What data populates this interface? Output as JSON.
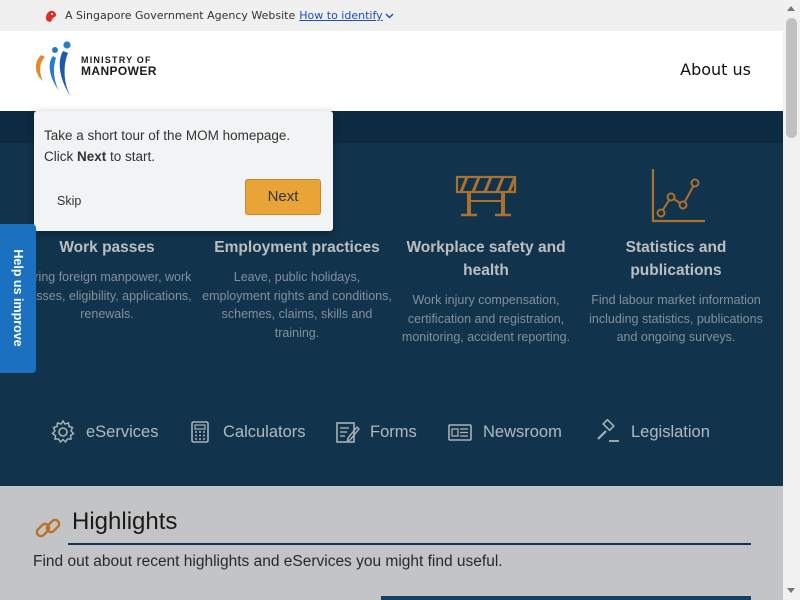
{
  "gov_banner": {
    "text": "A Singapore Government Agency Website",
    "link": "How to identify"
  },
  "header": {
    "logo_line1": "MINISTRY OF",
    "logo_line2": "MANPOWER",
    "about_us": "About us"
  },
  "categories": [
    {
      "title": "Work passes",
      "desc": "Hiring foreign manpower, work passes, eligibility, applications, renewals.",
      "icon": "id-card-icon"
    },
    {
      "title": "Employment practices",
      "desc": "Leave, public holidays, employment rights and conditions, schemes, claims, skills and training.",
      "icon": "envelope-icon"
    },
    {
      "title": "Workplace safety and health",
      "desc": "Work injury compensation, certification and registration, monitoring, accident reporting.",
      "icon": "barricade-icon"
    },
    {
      "title": "Statistics and publications",
      "desc": "Find labour market information including statistics, publications and ongoing surveys.",
      "icon": "line-chart-icon"
    }
  ],
  "quick_links": [
    {
      "label": "eServices",
      "icon": "gear-icon"
    },
    {
      "label": "Calculators",
      "icon": "calculator-icon"
    },
    {
      "label": "Forms",
      "icon": "form-icon"
    },
    {
      "label": "Newsroom",
      "icon": "newspaper-icon"
    },
    {
      "label": "Legislation",
      "icon": "gavel-icon"
    }
  ],
  "highlights": {
    "title": "Highlights",
    "desc": "Find out about recent highlights and eServices you might find useful."
  },
  "tour": {
    "line1": "Take a short tour of the MOM homepage.",
    "line2_pre": "Click ",
    "line2_bold": "Next",
    "line2_post": " to start.",
    "skip": "Skip",
    "next": "Next"
  },
  "feedback_tab": "Help us improve",
  "colors": {
    "hero_bg": "#153f5c",
    "tour_button": "#e8a436",
    "feedback_tab": "#1c70c0",
    "accent_orange": "#e38b2c"
  }
}
